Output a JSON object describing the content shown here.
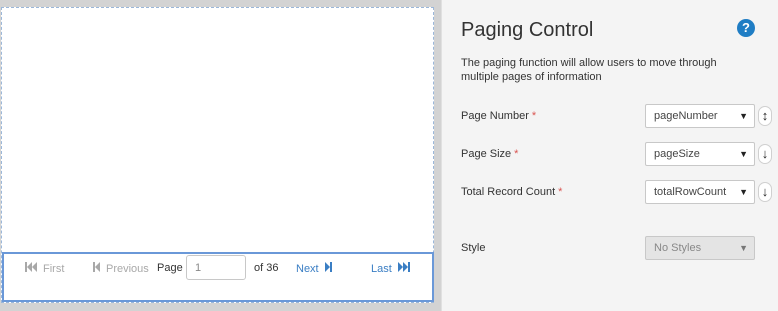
{
  "pager": {
    "first": "First",
    "previous": "Previous",
    "page_label": "Page",
    "page_value": "1",
    "of_label": "of 36",
    "next": "Next",
    "last": "Last"
  },
  "panel": {
    "title": "Paging Control",
    "help": "?",
    "description": "The paging function will allow users to move through multiple pages of information",
    "fields": [
      {
        "label": "Page Number",
        "required": "*",
        "value": "pageNumber",
        "direction": "↕"
      },
      {
        "label": "Page Size",
        "required": "*",
        "value": "pageSize",
        "direction": "↓"
      },
      {
        "label": "Total Record Count",
        "required": "*",
        "value": "totalRowCount",
        "direction": "↓"
      }
    ],
    "style": {
      "label": "Style",
      "value": "No Styles"
    }
  },
  "colors": {
    "accent": "#3a7ec4",
    "help_icon": "#1f7dc4",
    "required": "#d9534f",
    "disabled_text": "#a8a8a8"
  }
}
